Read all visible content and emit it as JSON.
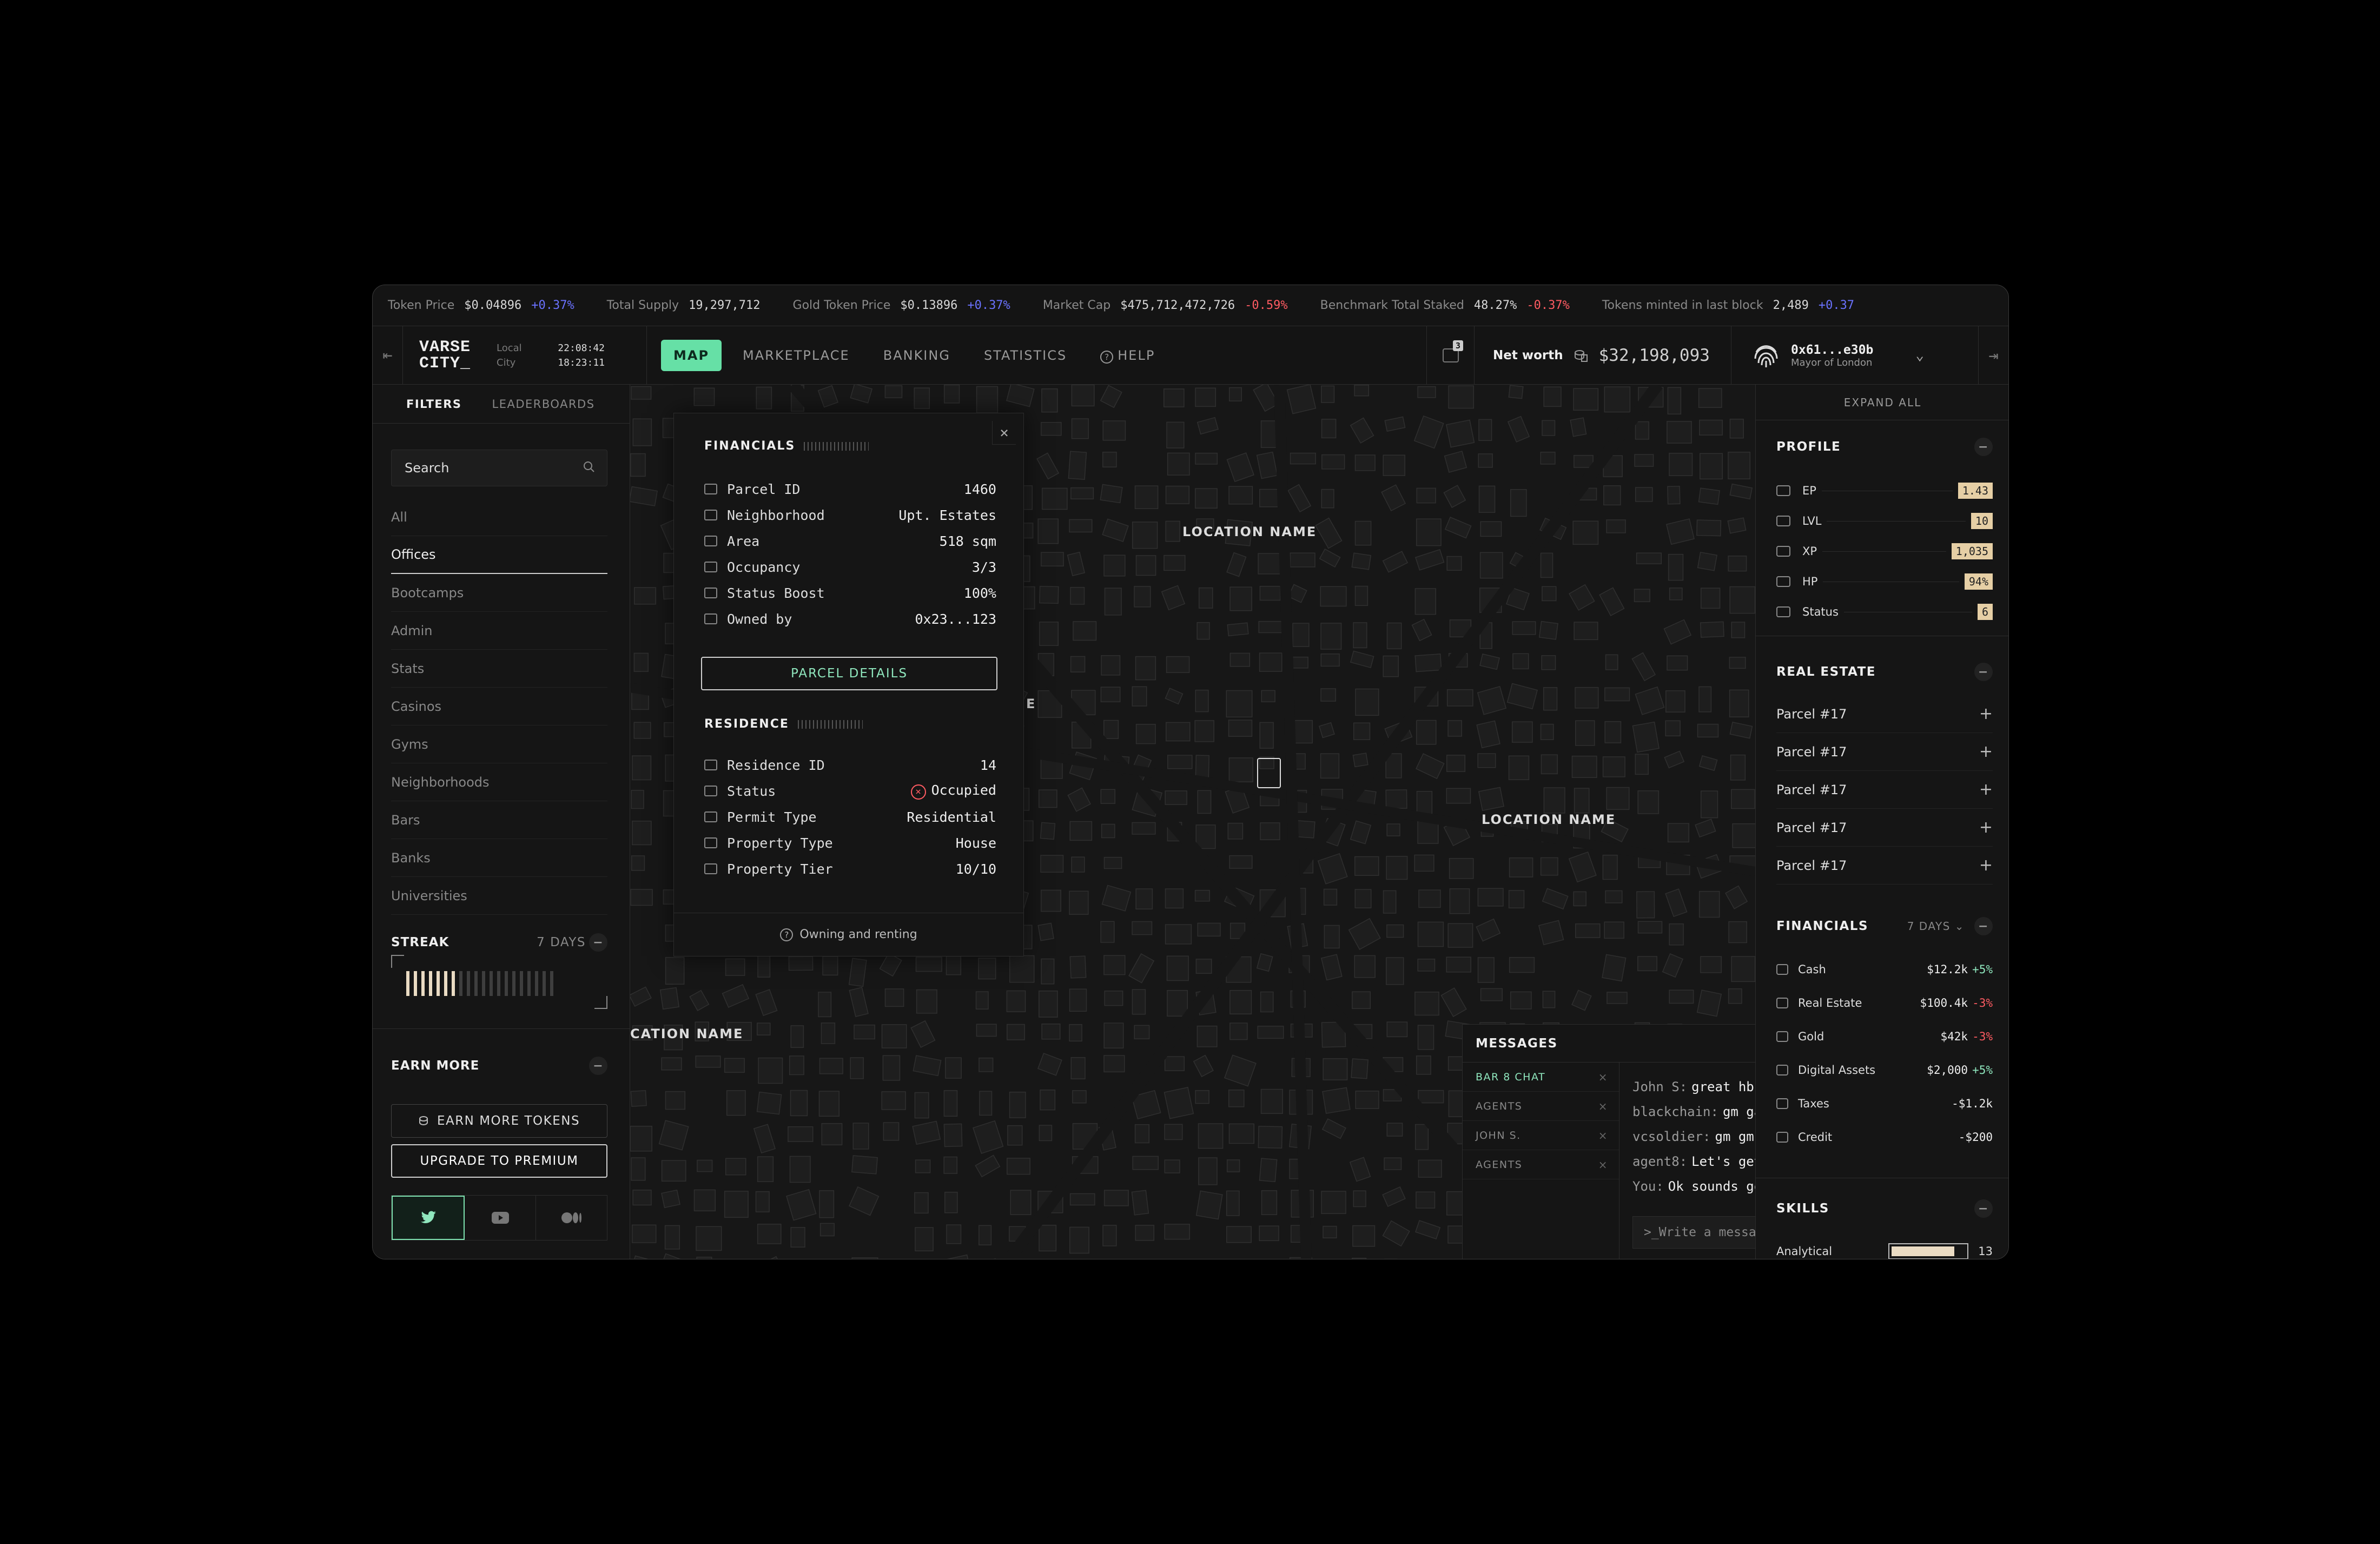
{
  "ticker": [
    {
      "label": "Token Price",
      "value": "$0.04896",
      "change": "+0.37%",
      "dir": "up"
    },
    {
      "label": "Total Supply",
      "value": "19,297,712",
      "change": "",
      "dir": ""
    },
    {
      "label": "Gold Token Price",
      "value": "$0.13896",
      "change": "+0.37%",
      "dir": "up"
    },
    {
      "label": "Market Cap",
      "value": "$475,712,472,726",
      "change": "-0.59%",
      "dir": "dn"
    },
    {
      "label": "Benchmark Total Staked",
      "value": "48.27%",
      "change": "-0.37%",
      "dir": "dn"
    },
    {
      "label": "Tokens minted in last block",
      "value": "2,489",
      "change": "+0.37",
      "dir": "up"
    }
  ],
  "header": {
    "logo": "VARSE CITY_",
    "clocks": {
      "local_label": "Local",
      "local_time": "22:08:42",
      "city_label": "City",
      "city_time": "18:23:11"
    },
    "nav": [
      "MAP",
      "MARKETPLACE",
      "BANKING",
      "STATISTICS",
      "HELP"
    ],
    "active_nav": "MAP",
    "notification_count": "3",
    "networth_label": "Net worth",
    "networth_value": "$32,198,093",
    "user_address": "0x61...e30b",
    "user_role": "Mayor of London"
  },
  "left": {
    "tabs": [
      "FILTERS",
      "LEADERBOARDS"
    ],
    "search_placeholder": "Search",
    "filters": [
      "All",
      "Offices",
      "Bootcamps",
      "Admin",
      "Stats",
      "Casinos",
      "Gyms",
      "Neighborhoods",
      "Bars",
      "Banks",
      "Universities"
    ],
    "active_filter": "Offices",
    "streak": {
      "title": "STREAK",
      "period": "7 DAYS",
      "filled": 7,
      "total": 20
    },
    "earn": {
      "title": "EARN MORE",
      "earn_tokens": "EARN MORE TOKENS",
      "upgrade": "UPGRADE TO PREMIUM"
    },
    "social_icons": [
      "twitter-icon",
      "youtube-icon",
      "medium-icon"
    ]
  },
  "map": {
    "labels": [
      "LOCATION NAME",
      "LOCATION NAME",
      "CATION NAME",
      "E"
    ]
  },
  "parcel": {
    "financials_title": "FINANCIALS",
    "financials": [
      {
        "label": "Parcel ID",
        "value": "1460",
        "icon": "scan-icon"
      },
      {
        "label": "Neighborhood",
        "value": "Upt. Estates",
        "icon": "diamond-icon"
      },
      {
        "label": "Area",
        "value": "518 sqm",
        "icon": "ruler-icon"
      },
      {
        "label": "Occupancy",
        "value": "3/3",
        "icon": "building-icon"
      },
      {
        "label": "Status Boost",
        "value": "100%",
        "icon": "check-badge-icon"
      },
      {
        "label": "Owned by",
        "value": "0x23...123",
        "icon": "id-card-icon"
      }
    ],
    "details_button": "PARCEL DETAILS",
    "residence_title": "RESIDENCE",
    "residence": [
      {
        "label": "Residence ID",
        "value": "14",
        "icon": "scan-icon"
      },
      {
        "label": "Status",
        "value": "Occupied",
        "icon": "toggle-icon"
      },
      {
        "label": "Permit Type",
        "value": "Residential",
        "icon": "clipboard-icon"
      },
      {
        "label": "Property Type",
        "value": "House",
        "icon": "house-icon"
      },
      {
        "label": "Property Tier",
        "value": "10/10",
        "icon": "tier-icon"
      }
    ],
    "footer": "Owning and renting"
  },
  "messages": {
    "title": "MESSAGES",
    "channels": [
      "BAR 8 CHAT",
      "AGENTS",
      "JOHN S.",
      "AGENTS"
    ],
    "active_channel": "BAR 8 CHAT",
    "lines": [
      {
        "who": "John S:",
        "text": "great hbu"
      },
      {
        "who": "blackchain:",
        "text": "gm gang hows everyone?"
      },
      {
        "who": "vcsoldier:",
        "text": "gm gm! let's do it"
      },
      {
        "who": "agent8:",
        "text": "Let's get to work! need to buy a property"
      },
      {
        "who": "You:",
        "text": "Ok sounds good 👀"
      }
    ],
    "input_placeholder": ">_Write a message"
  },
  "right": {
    "expand_all": "EXPAND ALL",
    "profile_title": "PROFILE",
    "profile": [
      {
        "label": "EP",
        "value": "1.43"
      },
      {
        "label": "LVL",
        "value": "10"
      },
      {
        "label": "XP",
        "value": "1,035"
      },
      {
        "label": "HP",
        "value": "94%"
      },
      {
        "label": "Status",
        "value": "6"
      }
    ],
    "real_estate_title": "REAL ESTATE",
    "real_estate": [
      "Parcel #17",
      "Parcel #17",
      "Parcel #17",
      "Parcel #17",
      "Parcel #17"
    ],
    "financials_title": "FINANCIALS",
    "financials_period": "7 DAYS",
    "financials": [
      {
        "label": "Cash",
        "value": "$12.2k",
        "change": "+5%",
        "dir": "up"
      },
      {
        "label": "Real Estate",
        "value": "$100.4k",
        "change": "-3%",
        "dir": "dn"
      },
      {
        "label": "Gold",
        "value": "$42k",
        "change": "-3%",
        "dir": "dn"
      },
      {
        "label": "Digital Assets",
        "value": "$2,000",
        "change": "+5%",
        "dir": "up"
      },
      {
        "label": "Taxes",
        "value": "-$1.2k",
        "change": "",
        "dir": ""
      },
      {
        "label": "Credit",
        "value": "-$200",
        "change": "",
        "dir": ""
      }
    ],
    "skills_title": "SKILLS",
    "skill": {
      "label": "Analytical",
      "value": "13",
      "level": 0.85
    }
  },
  "colors": {
    "accent": "#66e0a6",
    "up": "#6a72ff",
    "down": "#ff5b62",
    "chip": "#e6cfa5"
  }
}
